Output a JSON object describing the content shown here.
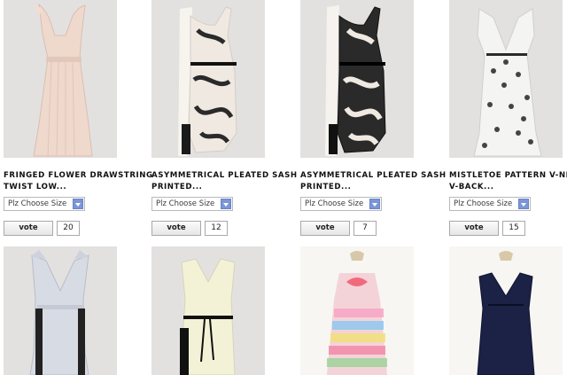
{
  "products_row1": [
    {
      "title_line1": "FRINGED FLOWER DRAWSTRING",
      "title_line2": "TWIST LOW...",
      "size_select": "Plz Choose Size",
      "vote_button": "vote",
      "vote_count": "20",
      "image_icon": "dress-photo-icon"
    },
    {
      "title_line1": "ASYMMETRICAL PLEATED SASH",
      "title_line2": "PRINTED...",
      "size_select": "Plz Choose Size",
      "vote_button": "vote",
      "vote_count": "12",
      "image_icon": "dress-photo-icon"
    },
    {
      "title_line1": "ASYMMETRICAL PLEATED SASH",
      "title_line2": "PRINTED...",
      "size_select": "Plz Choose Size",
      "vote_button": "vote",
      "vote_count": "7",
      "image_icon": "dress-photo-icon"
    },
    {
      "title_line1": "MISTLETOE PATTERN V-NECK",
      "title_line2": "V-BACK...",
      "size_select": "Plz Choose Size",
      "vote_button": "vote",
      "vote_count": "15",
      "image_icon": "dress-photo-icon"
    }
  ],
  "products_row2_images": [
    "dress-photo-icon",
    "dress-photo-icon",
    "dress-photo-icon",
    "dress-photo-icon"
  ],
  "colors": {
    "photo_bg": "#e3e1e0",
    "select_arrow": "#7b96d8"
  }
}
